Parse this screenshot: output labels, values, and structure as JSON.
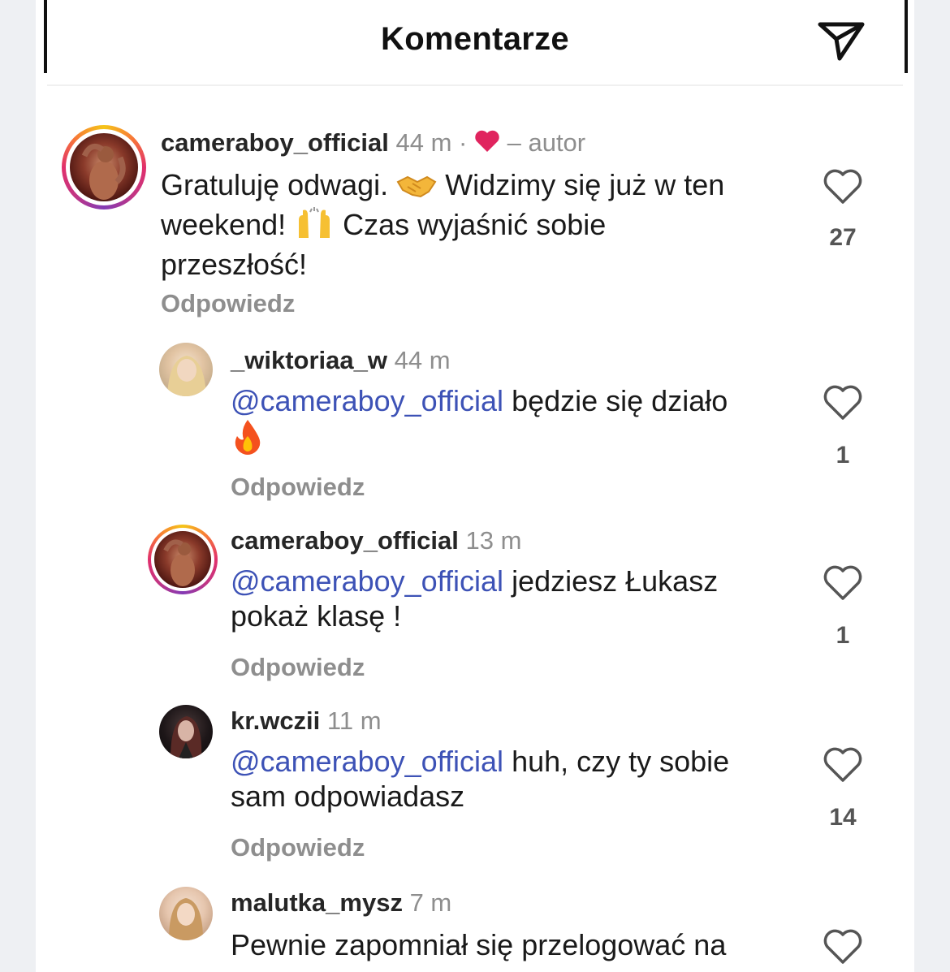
{
  "header": {
    "title": "Komentarze",
    "send_icon": "paper-plane-icon"
  },
  "colors": {
    "mention": "#3d52b6",
    "meta": "#8e8e8e",
    "heart": "#e0245e"
  },
  "comments": [
    {
      "username": "cameraboy_official",
      "time": "44 m",
      "separator": "·",
      "author_tag": "– autor",
      "author_liked": true,
      "text_1": "Gratuluję odwagi.",
      "text_2": "Widzimy się już w ten",
      "text_3": "weekend!",
      "text_4": "Czas wyjaśnić sobie",
      "text_5": "przeszłość!",
      "emoji_1": "handshake-emoji",
      "emoji_2": "raising-hands-emoji",
      "reply": "Odpowiedz",
      "likes": "27"
    },
    {
      "username": "_wiktoriaa_w",
      "time": "44 m",
      "mention": "@cameraboy_official",
      "text": "będzie się działo",
      "emoji": "fire-emoji",
      "reply": "Odpowiedz",
      "likes": "1"
    },
    {
      "username": "cameraboy_official",
      "time": "13 m",
      "mention": "@cameraboy_official",
      "text_1": "jedziesz Łukasz",
      "text_2": "pokaż klasę !",
      "reply": "Odpowiedz",
      "likes": "1"
    },
    {
      "username": "kr.wczii",
      "time": "11 m",
      "mention": "@cameraboy_official",
      "text_1": "huh, czy ty sobie",
      "text_2": "sam odpowiadasz",
      "reply": "Odpowiedz",
      "likes": "14"
    },
    {
      "username": "malutka_mysz",
      "time": "7 m",
      "text_1": "Pewnie zapomniał się przelogować na"
    }
  ]
}
